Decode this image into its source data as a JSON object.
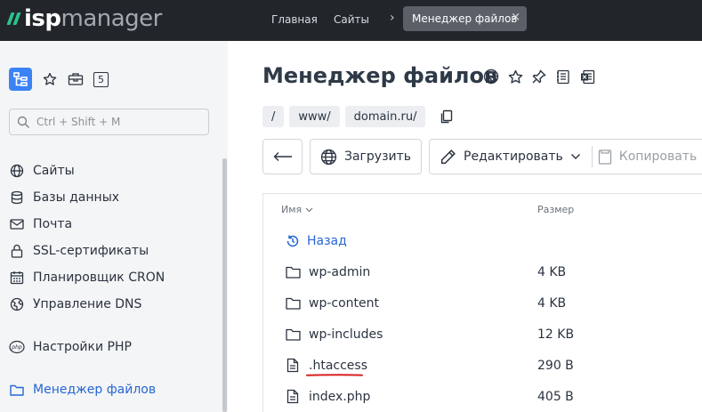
{
  "app": {
    "logo_prefix": "isp",
    "logo_suffix": "manager",
    "accent_color": "#2bc38a",
    "link_color": "#2766d6",
    "annotation_color": "#d92020"
  },
  "topbar": {
    "crumb_home": "Главная",
    "crumb_sites": "Сайты",
    "separator": "›",
    "active_tab": "Менеджер файлов",
    "close_glyph": "×"
  },
  "sidebar": {
    "tools": [
      "tree-icon",
      "star-icon",
      "briefcase-icon",
      "counter-badge"
    ],
    "badge_count": "5",
    "search_placeholder": "Ctrl + Shift + M",
    "items": [
      {
        "label": "Сайты",
        "icon": "globe-icon"
      },
      {
        "label": "Базы данных",
        "icon": "database-icon"
      },
      {
        "label": "Почта",
        "icon": "mail-icon"
      },
      {
        "label": "SSL-сертификаты",
        "icon": "lock-icon"
      },
      {
        "label": "Планировщик CRON",
        "icon": "calendar-icon"
      },
      {
        "label": "Управление DNS",
        "icon": "dns-globe-icon"
      },
      {
        "label": "Настройки PHP",
        "icon": "php-icon"
      },
      {
        "label": "Менеджер файлов",
        "icon": "folder-icon",
        "active": true
      }
    ]
  },
  "main": {
    "title": "Менеджер файлов",
    "title_icons": [
      "globe-icon",
      "star-icon",
      "pin-icon",
      "notes-icon",
      "excel-icon"
    ],
    "path": [
      "/",
      "www/",
      "domain.ru/"
    ],
    "toolbar": {
      "back_icon": "arrow-left-icon",
      "upload": "Загрузить",
      "edit": "Редактировать",
      "copy": "Копировать"
    },
    "table": {
      "col_name": "Имя",
      "col_size": "Размер",
      "back_label": "Назад",
      "rows": [
        {
          "name": "wp-admin",
          "size": "4 KB",
          "type": "folder"
        },
        {
          "name": "wp-content",
          "size": "4 KB",
          "type": "folder"
        },
        {
          "name": "wp-includes",
          "size": "12 KB",
          "type": "folder"
        },
        {
          "name": ".htaccess",
          "size": "290 B",
          "type": "file",
          "highlighted": true
        },
        {
          "name": "index.php",
          "size": "405 B",
          "type": "file"
        }
      ]
    }
  }
}
